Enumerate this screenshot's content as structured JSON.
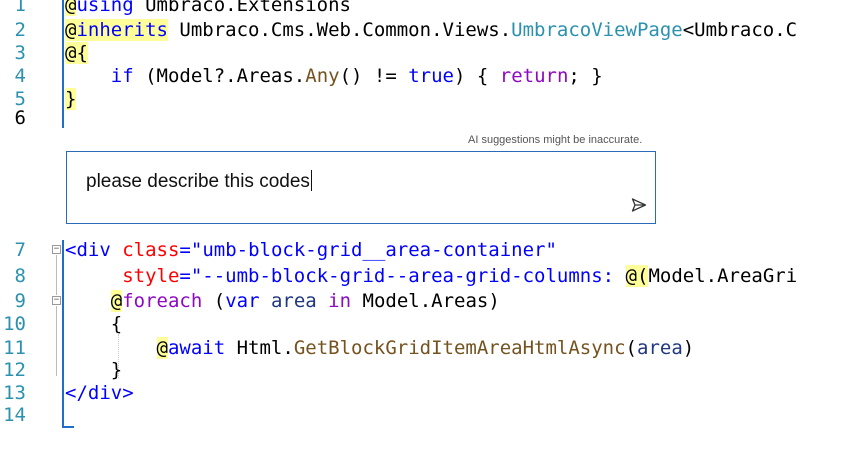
{
  "line_numbers": [
    "1",
    "2",
    "3",
    "4",
    "5",
    "6",
    "7",
    "8",
    "9",
    "10",
    "11",
    "12",
    "13",
    "14"
  ],
  "code": {
    "l1": {
      "at": "@",
      "kw": "using",
      "rest": " Umbraco.Extensions"
    },
    "l2": {
      "at": "@",
      "kw": "inherits",
      "ns": " Umbraco.Cms.Web.Common.Views.",
      "type": "UmbracoViewPage",
      "tail": "<Umbraco.C"
    },
    "l3": {
      "text": "@{"
    },
    "l4": {
      "indent": "    ",
      "if": "if",
      "p1": " (Model?.Areas.",
      "any": "Any",
      "p2": "() != ",
      "true": "true",
      "p3": ") { ",
      "ret": "return",
      "p4": "; }"
    },
    "l5": {
      "text": "}"
    },
    "l7": {
      "open": "<div",
      "sp": " ",
      "attr": "class",
      "eq": "=",
      "val": "\"umb-block-grid__area-container\""
    },
    "l8": {
      "indent": "     ",
      "attr": "style",
      "eq": "=",
      "val": "\"--umb-block-grid--area-grid-columns: ",
      "razor": "@(",
      "tail": "Model.AreaGri"
    },
    "l9": {
      "indent": "    ",
      "at": "@",
      "kw": "foreach",
      "p1": " (",
      "var": "var",
      "sp": " ",
      "area": "area",
      "in": " in ",
      "tail": "Model.Areas)"
    },
    "l10": {
      "indent": "    ",
      "text": "{"
    },
    "l11": {
      "indent": "        ",
      "at": "@",
      "kw": "await",
      "p1": " Html.",
      "meth": "GetBlockGridItemAreaHtmlAsync",
      "p2": "(",
      "arg": "area",
      "p3": ")"
    },
    "l12": {
      "indent": "    ",
      "text": "}"
    },
    "l13": {
      "close": "</div>"
    }
  },
  "ai_note": "AI suggestions might be inaccurate.",
  "chat": {
    "input_value": "please describe this codes"
  },
  "colors": {
    "accent": "#1e6fc8",
    "keyword": "#0000ff",
    "control": "#8f08c4",
    "type": "#2b91af",
    "method": "#74531f",
    "string": "#a31515",
    "attribute": "#ff0000",
    "razor_highlight": "#ffff99"
  },
  "icons": {
    "send": "send-icon",
    "collapse": "collapse-icon"
  }
}
